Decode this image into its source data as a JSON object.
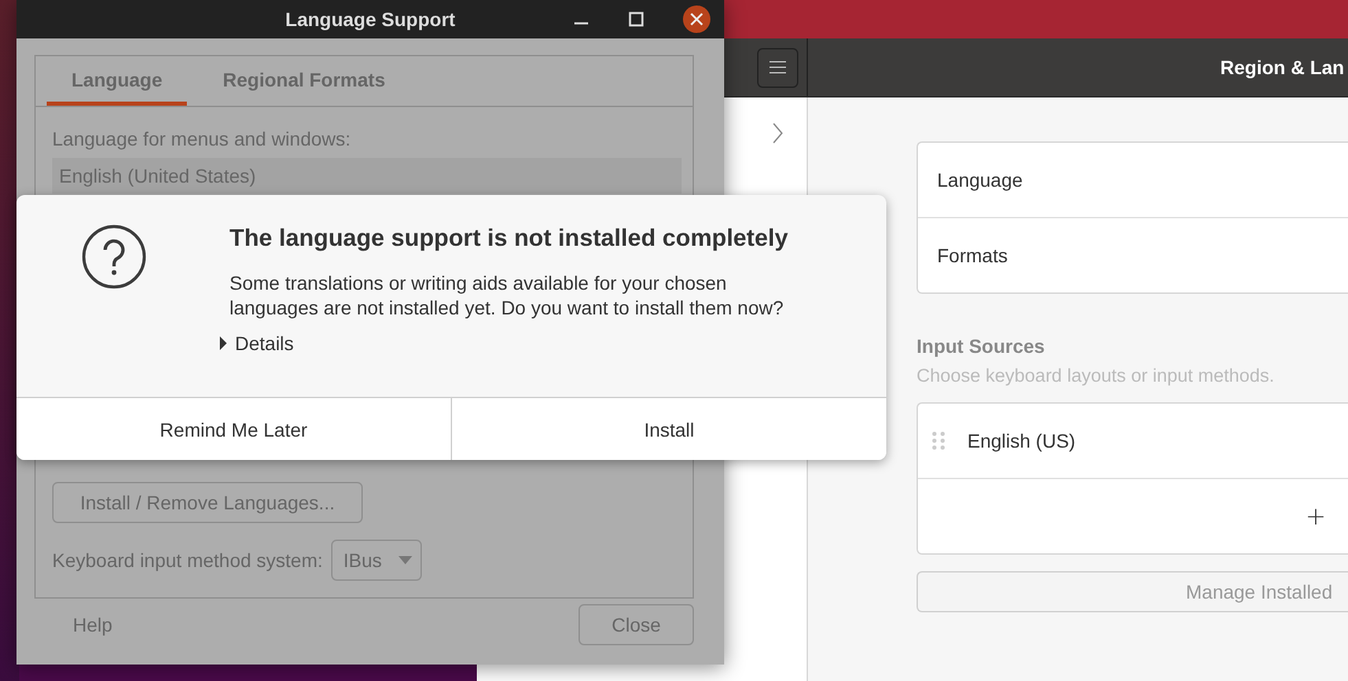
{
  "language_support_window": {
    "title": "Language Support",
    "tabs": [
      {
        "label": "Language",
        "selected": true
      },
      {
        "label": "Regional Formats",
        "selected": false
      }
    ],
    "menu_language_label": "Language for menus and windows:",
    "menu_language_value": "English (United States)",
    "install_remove_button": "Install / Remove Languages...",
    "input_method_label": "Keyboard input method system:",
    "input_method_value": "IBus",
    "help_button": "Help",
    "close_button": "Close"
  },
  "dialog": {
    "title": "The language support is not installed completely",
    "message": "Some translations or writing aids available for your chosen languages are not installed yet. Do you want to install them now?",
    "details": {
      "label": "Details",
      "expanded": false
    },
    "buttons": [
      "Remind Me Later",
      "Install"
    ]
  },
  "settings_window": {
    "title": "Region & Lan",
    "rows": [
      "Language",
      "Formats"
    ],
    "input_sources_heading": "Input Sources",
    "input_sources_hint": "Choose keyboard layouts or input methods.",
    "input_sources": [
      {
        "name": "English (US)"
      }
    ],
    "add_button": "+",
    "manage_button": "Manage Installed"
  }
}
